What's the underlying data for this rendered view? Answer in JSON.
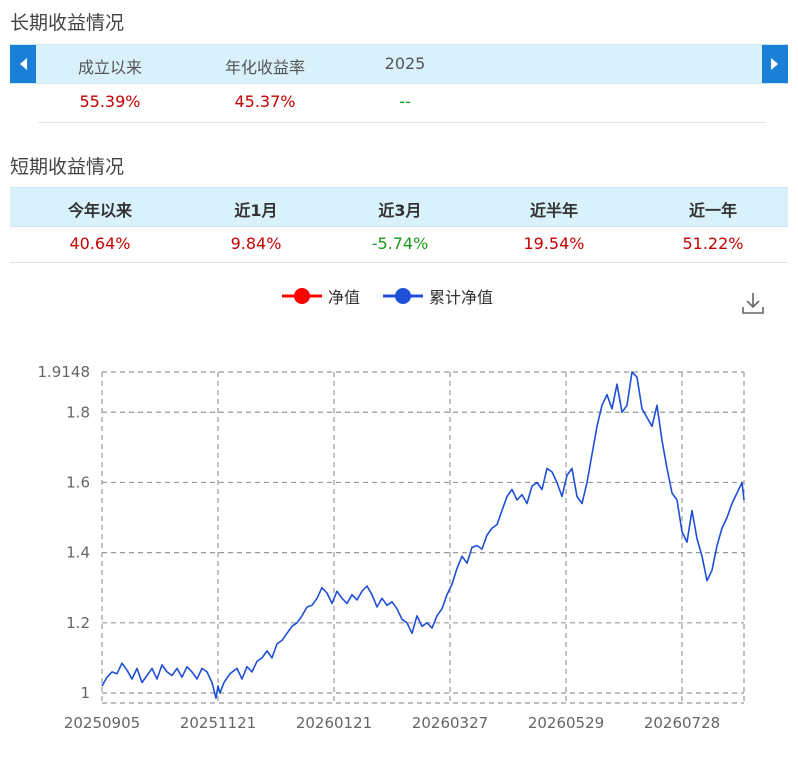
{
  "long_term": {
    "title": "长期收益情况",
    "headers": [
      "成立以来",
      "年化收益率",
      "2025"
    ],
    "values": [
      "55.39%",
      "45.37%",
      "--"
    ]
  },
  "short_term": {
    "title": "短期收益情况",
    "headers": [
      "今年以来",
      "近1月",
      "近3月",
      "近半年",
      "近一年"
    ],
    "values": [
      "40.64%",
      "9.84%",
      "-5.74%",
      "19.54%",
      "51.22%"
    ]
  },
  "legend": {
    "nav": "净值",
    "cumulative_nav": "累计净值"
  },
  "colors": {
    "nav": "#ff0000",
    "cumulative_nav": "#1f4fd6",
    "header_bg": "#d9f1fb",
    "positive": "#c40000",
    "negative": "#1a9a1a",
    "accent": "#1a7fd6"
  },
  "icons": {
    "left": "caret-left-icon",
    "right": "caret-right-icon",
    "download": "download-icon"
  },
  "chart_data": {
    "type": "line",
    "x_tick_labels": [
      "20250905",
      "20251121",
      "20260121",
      "20260327",
      "20260529",
      "20260728"
    ],
    "y_ticks": [
      1,
      1.2,
      1.4,
      1.6,
      1.8,
      1.9148
    ],
    "y_tick_labels": [
      "1",
      "1.2",
      "1.4",
      "1.6",
      "1.8",
      "1.9148"
    ],
    "ylim": [
      0.975,
      1.9148
    ],
    "grid": true,
    "legend_position": "top-center",
    "series": [
      {
        "name": "累计净值",
        "x": [
          0,
          5,
          10,
          15,
          20,
          25,
          30,
          35,
          40,
          45,
          50,
          55,
          60,
          65,
          70,
          75,
          80,
          85,
          90,
          95,
          100,
          105,
          110,
          114,
          116,
          118,
          122,
          128,
          135,
          140,
          145,
          150,
          155,
          160,
          165,
          170,
          175,
          180,
          185,
          190,
          195,
          200,
          205,
          210,
          215,
          220,
          225,
          230,
          235,
          240,
          245,
          250,
          255,
          260,
          265,
          270,
          275,
          280,
          285,
          290,
          295,
          300,
          305,
          310,
          315,
          320,
          325,
          330,
          335,
          340,
          345,
          350,
          355,
          360,
          365,
          370,
          375,
          380,
          385,
          390,
          395,
          400,
          405,
          410,
          415,
          420,
          425,
          430,
          435,
          440,
          445,
          450,
          455,
          460,
          465,
          470,
          475,
          480,
          485,
          490,
          495,
          500,
          505,
          510,
          515,
          520,
          525,
          530,
          535,
          540,
          545,
          550,
          555,
          560,
          565,
          570,
          575,
          580,
          585,
          590,
          595,
          600,
          605,
          610,
          615,
          620,
          625,
          630,
          635,
          640,
          642
        ],
        "values": [
          1.02,
          1.045,
          1.06,
          1.055,
          1.085,
          1.065,
          1.04,
          1.07,
          1.03,
          1.05,
          1.07,
          1.04,
          1.08,
          1.06,
          1.05,
          1.07,
          1.045,
          1.075,
          1.06,
          1.04,
          1.07,
          1.06,
          1.03,
          0.985,
          1.02,
          1.0,
          1.03,
          1.055,
          1.07,
          1.04,
          1.075,
          1.06,
          1.09,
          1.1,
          1.12,
          1.1,
          1.14,
          1.15,
          1.17,
          1.19,
          1.2,
          1.22,
          1.245,
          1.25,
          1.27,
          1.3,
          1.285,
          1.255,
          1.29,
          1.27,
          1.255,
          1.28,
          1.265,
          1.29,
          1.305,
          1.28,
          1.245,
          1.27,
          1.25,
          1.26,
          1.24,
          1.21,
          1.2,
          1.17,
          1.22,
          1.19,
          1.2,
          1.185,
          1.22,
          1.24,
          1.28,
          1.31,
          1.355,
          1.39,
          1.37,
          1.415,
          1.42,
          1.41,
          1.45,
          1.47,
          1.48,
          1.52,
          1.56,
          1.58,
          1.55,
          1.565,
          1.54,
          1.59,
          1.6,
          1.58,
          1.64,
          1.63,
          1.6,
          1.56,
          1.62,
          1.64,
          1.56,
          1.54,
          1.6,
          1.68,
          1.76,
          1.82,
          1.85,
          1.81,
          1.88,
          1.8,
          1.82,
          1.9148,
          1.9,
          1.81,
          1.785,
          1.76,
          1.82,
          1.72,
          1.64,
          1.57,
          1.55,
          1.46,
          1.43,
          1.52,
          1.44,
          1.39,
          1.32,
          1.35,
          1.42,
          1.47,
          1.5,
          1.54,
          1.57,
          1.6,
          1.55
        ]
      }
    ]
  }
}
